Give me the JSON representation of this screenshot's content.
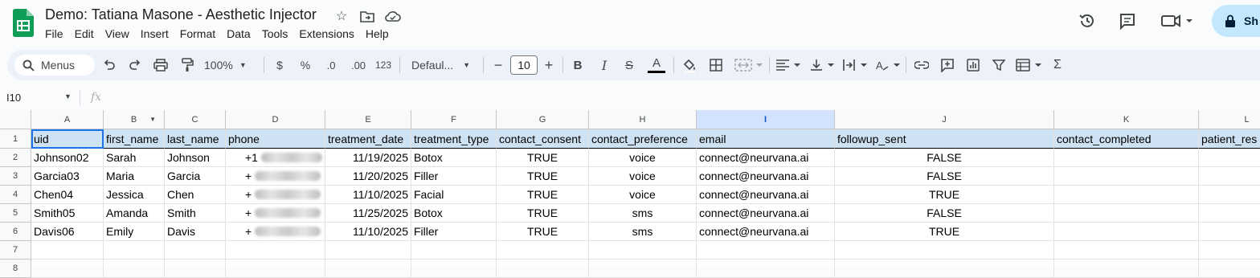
{
  "doc": {
    "title": "Demo: Tatiana Masone - Aesthetic Injector"
  },
  "menu": [
    "File",
    "Edit",
    "View",
    "Insert",
    "Format",
    "Data",
    "Tools",
    "Extensions",
    "Help"
  ],
  "share": {
    "label": "Sh"
  },
  "toolbar": {
    "search_label": "Menus",
    "zoom": "100%",
    "currency": "$",
    "percent": "%",
    "dec_decrease": ".0",
    "dec_increase": ".00",
    "number_format": "123",
    "font": "Defaul...",
    "font_size": "10",
    "bold": "B",
    "italic": "I",
    "strike": "S",
    "text_color": "A",
    "sum": "Σ"
  },
  "formula_bar": {
    "name_box": "I10",
    "fx": "fx"
  },
  "columns": [
    "A",
    "B",
    "C",
    "D",
    "E",
    "F",
    "G",
    "H",
    "I",
    "J",
    "K",
    "L"
  ],
  "rows": [
    "1",
    "2",
    "3",
    "4",
    "5",
    "6",
    "7",
    "8"
  ],
  "headers": [
    "uid",
    "first_name",
    "last_name",
    "phone",
    "treatment_date",
    "treatment_type",
    "contact_consent",
    "contact_preference",
    "email",
    "followup_sent",
    "contact_completed",
    "patient_res"
  ],
  "data": [
    [
      "Johnson02",
      "Sarah",
      "Johnson",
      "+1",
      "11/19/2025",
      "Botox",
      "TRUE",
      "voice",
      "connect@neurvana.ai",
      "FALSE",
      "",
      ""
    ],
    [
      "Garcia03",
      "Maria",
      "Garcia",
      "+",
      "11/20/2025",
      "Filler",
      "TRUE",
      "voice",
      "connect@neurvana.ai",
      "FALSE",
      "",
      ""
    ],
    [
      "Chen04",
      "Jessica",
      "Chen",
      "+",
      "11/10/2025",
      "Facial",
      "TRUE",
      "voice",
      "connect@neurvana.ai",
      "TRUE",
      "",
      ""
    ],
    [
      "Smith05",
      "Amanda",
      "Smith",
      "+",
      "11/25/2025",
      "Botox",
      "TRUE",
      "sms",
      "connect@neurvana.ai",
      "FALSE",
      "",
      ""
    ],
    [
      "Davis06",
      "Emily",
      "Davis",
      "+",
      "11/10/2025",
      "Filler",
      "TRUE",
      "sms",
      "connect@neurvana.ai",
      "TRUE",
      "",
      ""
    ]
  ],
  "colors": {
    "accent": "#1a73e8",
    "header_fill": "#cfe2f3",
    "sheets_green": "#0f9d58",
    "share_bg": "#c2e7ff"
  }
}
